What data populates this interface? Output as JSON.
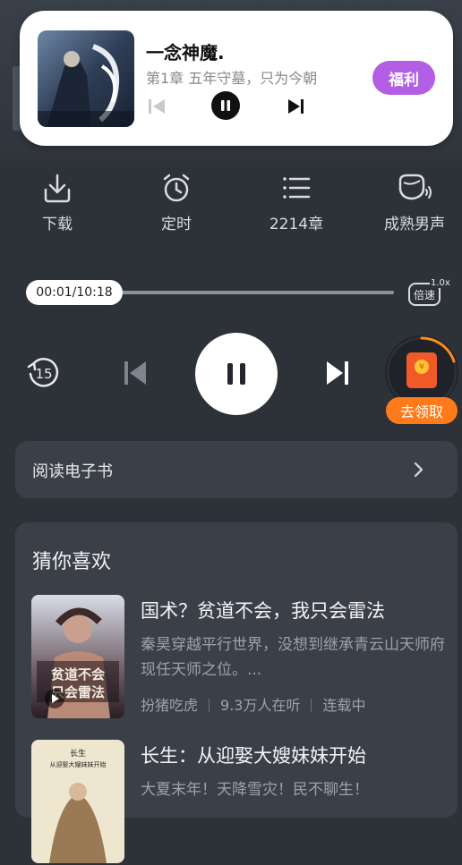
{
  "mini_player": {
    "title": "一念神魔.",
    "subtitle": "第1章 五年守墓，只为今朝",
    "reward_button": "福利"
  },
  "toolbar": {
    "items": [
      {
        "label": "下载",
        "icon": "download-icon"
      },
      {
        "label": "定时",
        "icon": "alarm-clock-icon"
      },
      {
        "label": "2214章",
        "icon": "chapter-list-icon"
      },
      {
        "label": "成熟男声",
        "icon": "voice-icon"
      }
    ]
  },
  "progress": {
    "time_text": "00:01/10:18",
    "fraction": 0.0016,
    "speed_label": "倍速",
    "speed_value": "1.0x"
  },
  "controls": {
    "rewind_seconds": "15",
    "state": "playing"
  },
  "reward_widget": {
    "label": "去领取"
  },
  "ebook": {
    "label": "阅读电子书"
  },
  "recommend": {
    "title": "猜你喜欢",
    "books": [
      {
        "title": "国术？贫道不会，我只会雷法",
        "desc": "秦昊穿越平行世界，没想到继承青云山天师府现任天师之位。...",
        "tags": [
          "扮猪吃虎",
          "9.3万人在听",
          "连载中"
        ]
      },
      {
        "title": "长生：从迎娶大嫂妹妹开始",
        "desc": "大夏末年！天降雪灾！民不聊生！",
        "tags": []
      }
    ]
  },
  "colors": {
    "background": "#2d3138",
    "card": "#3b4048",
    "reward_purple": "#b25fe6",
    "reward_orange": "#ff7a1a"
  }
}
